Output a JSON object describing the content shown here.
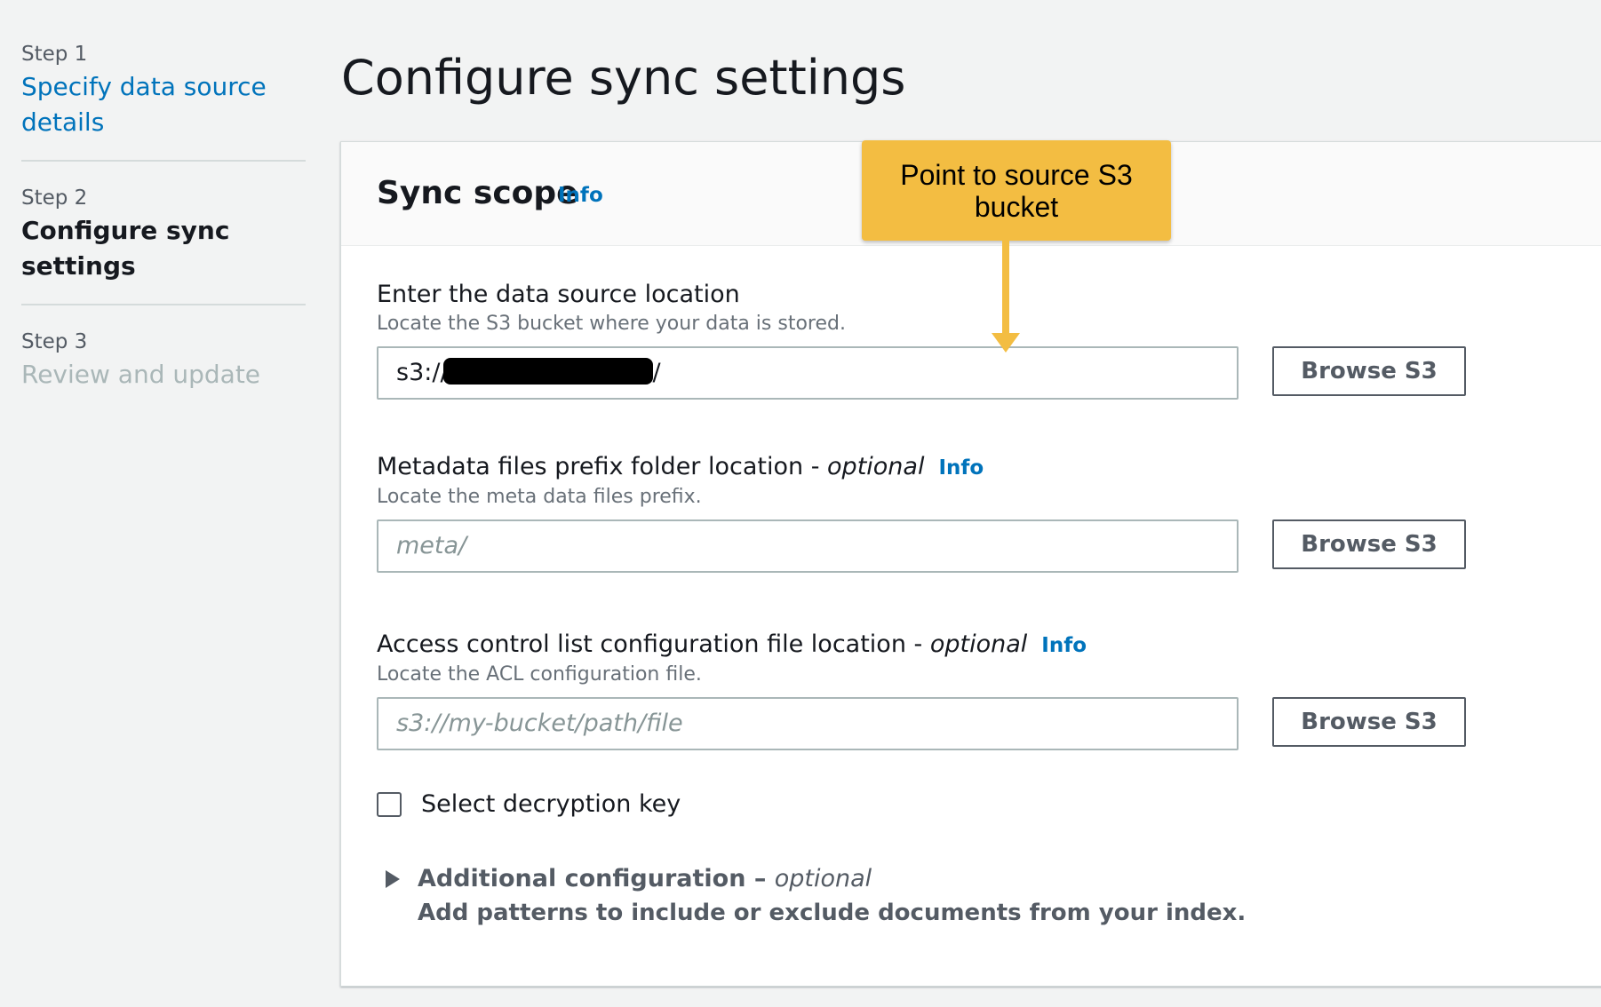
{
  "sidebar": {
    "steps": [
      {
        "number": "Step 1",
        "title": "Specify data source details",
        "state": "link"
      },
      {
        "number": "Step 2",
        "title": "Configure sync settings",
        "state": "current"
      },
      {
        "number": "Step 3",
        "title": "Review and update",
        "state": "disabled"
      }
    ]
  },
  "page": {
    "title": "Configure sync settings"
  },
  "panel": {
    "title": "Sync scope",
    "info": "Info",
    "fields": [
      {
        "label": "Enter the data source location",
        "optional": "",
        "info": "",
        "description": "Locate the S3 bucket where your data is stored.",
        "value_prefix": "s3://",
        "value_suffix": "/",
        "placeholder": "",
        "button": "Browse S3"
      },
      {
        "label": "Metadata files prefix folder location - ",
        "optional": "optional",
        "info": "Info",
        "description": "Locate the meta data files prefix.",
        "value_prefix": "",
        "value_suffix": "",
        "placeholder": "meta/",
        "button": "Browse S3"
      },
      {
        "label": "Access control list configuration file location - ",
        "optional": "optional",
        "info": "Info",
        "description": "Locate the ACL configuration file.",
        "value_prefix": "",
        "value_suffix": "",
        "placeholder": "s3://my-bucket/path/file",
        "button": "Browse S3"
      }
    ],
    "checkbox": {
      "label": "Select decryption key",
      "checked": false
    },
    "expander": {
      "title": "Additional configuration – ",
      "optional": "optional",
      "description": "Add patterns to include or exclude documents from your index.",
      "expanded": false
    }
  },
  "callout": {
    "text": "Point to source S3 bucket",
    "color": "#f3bd42"
  },
  "colors": {
    "link": "#0073bb",
    "background": "#f2f3f3",
    "disabled": "#aab7b8"
  },
  "icons": {
    "expander": "caret-right-icon",
    "callout_arrow": "arrow-down-icon"
  }
}
